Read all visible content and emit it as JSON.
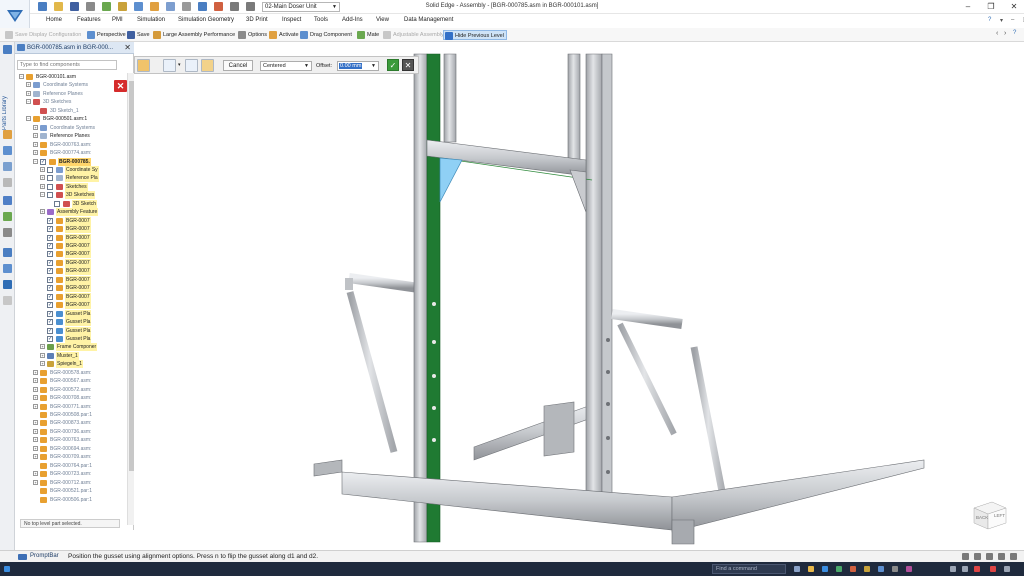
{
  "window": {
    "title": "Solid Edge - Assembly - [BGR-000785.asm in BGR-000101.asm]",
    "document_selector": "02-Main Doser Unit"
  },
  "menu": {
    "tabs": [
      "Home",
      "Features",
      "PMI",
      "Simulation",
      "Simulation Geometry",
      "3D Print",
      "Inspect",
      "Tools",
      "Add-Ins",
      "View",
      "Data Management"
    ]
  },
  "ribbon": {
    "save_display_configuration": "Save Display Configuration",
    "perspective": "Perspective",
    "save": "Save",
    "large_assembly_performance": "Large Assembly Performance",
    "options": "Options",
    "activate": "Activate",
    "drag_component": "Drag Component",
    "mate": "Mate",
    "adjustable_assembly": "Adjustable Assembly",
    "hide_previous_level": "Hide Previous Level"
  },
  "sidebar": {
    "pathfinder_tab": "Parts Library"
  },
  "pathfinder": {
    "tab_label": "BGR-000785.asm in BGR-000...",
    "search_placeholder": "Type to find components",
    "status": "No top level part selected.",
    "tree": [
      {
        "label": "BGR-000101.asm",
        "indent": 0,
        "exp": "-",
        "icon": "assembly",
        "style": "normal"
      },
      {
        "label": "Coordinate Systems",
        "indent": 1,
        "exp": "+",
        "icon": "coord",
        "style": "muted"
      },
      {
        "label": "Reference Planes",
        "indent": 1,
        "exp": "+",
        "icon": "plane",
        "style": "muted"
      },
      {
        "label": "3D Sketches",
        "indent": 1,
        "exp": "-",
        "icon": "sketch",
        "style": "muted"
      },
      {
        "label": "3D Sketch_1",
        "indent": 2,
        "icon": "sketch",
        "style": "muted"
      },
      {
        "label": "BGR-000501.asm:1",
        "indent": 1,
        "exp": "-",
        "icon": "assembly",
        "style": "normal"
      },
      {
        "label": "Coordinate Systems",
        "indent": 2,
        "exp": "+",
        "icon": "coord",
        "style": "muted"
      },
      {
        "label": "Reference Planes",
        "indent": 2,
        "exp": "+",
        "icon": "plane",
        "style": "normal"
      },
      {
        "label": "BGR-000763.asm:",
        "indent": 2,
        "exp": "+",
        "icon": "assembly",
        "style": "muted"
      },
      {
        "label": "BGR-000774.asm:",
        "indent": 2,
        "exp": "+",
        "icon": "assembly",
        "style": "muted"
      },
      {
        "label": "BGR-000785.",
        "indent": 2,
        "exp": "-",
        "check": true,
        "icon": "assembly",
        "style": "sel"
      },
      {
        "label": "Coordinate Sy",
        "indent": 3,
        "exp": "+",
        "check": false,
        "icon": "coord",
        "style": "hl"
      },
      {
        "label": "Reference Pla",
        "indent": 3,
        "exp": "+",
        "check": false,
        "icon": "plane",
        "style": "hl"
      },
      {
        "label": "Sketches",
        "indent": 3,
        "exp": "+",
        "check": false,
        "icon": "sketch",
        "style": "hl"
      },
      {
        "label": "3D Sketches",
        "indent": 3,
        "exp": "-",
        "check": false,
        "icon": "sketch",
        "style": "hl"
      },
      {
        "label": "3D Sketch",
        "indent": 4,
        "check": false,
        "icon": "sketch",
        "style": "hl"
      },
      {
        "label": "Assembly Feature",
        "indent": 3,
        "exp": "+",
        "icon": "feature",
        "style": "hl"
      },
      {
        "label": "BGR-0007",
        "indent": 3,
        "check": true,
        "icon": "part",
        "style": "hl"
      },
      {
        "label": "BGR-0007",
        "indent": 3,
        "check": true,
        "icon": "part",
        "style": "hl"
      },
      {
        "label": "BGR-0007",
        "indent": 3,
        "check": true,
        "icon": "part",
        "style": "hl"
      },
      {
        "label": "BGR-0007",
        "indent": 3,
        "check": true,
        "icon": "part",
        "style": "hl"
      },
      {
        "label": "BGR-0007",
        "indent": 3,
        "check": true,
        "icon": "part",
        "style": "hl"
      },
      {
        "label": "BGR-0007",
        "indent": 3,
        "check": true,
        "icon": "part",
        "style": "hl"
      },
      {
        "label": "BGR-0007",
        "indent": 3,
        "check": true,
        "icon": "part",
        "style": "hl"
      },
      {
        "label": "BGR-0007",
        "indent": 3,
        "check": true,
        "icon": "part",
        "style": "hl"
      },
      {
        "label": "BGR-0007",
        "indent": 3,
        "check": true,
        "icon": "part",
        "style": "hl"
      },
      {
        "label": "BGR-0007",
        "indent": 3,
        "check": true,
        "icon": "part",
        "style": "hl"
      },
      {
        "label": "BGR-0007",
        "indent": 3,
        "check": true,
        "icon": "part",
        "style": "hl"
      },
      {
        "label": "Gusset Pla",
        "indent": 3,
        "check": true,
        "icon": "gusset",
        "style": "hl"
      },
      {
        "label": "Gusset Pla",
        "indent": 3,
        "check": true,
        "icon": "gusset",
        "style": "hl"
      },
      {
        "label": "Gusset Pla",
        "indent": 3,
        "check": true,
        "icon": "gusset",
        "style": "hl"
      },
      {
        "label": "Gusset Pla",
        "indent": 3,
        "check": true,
        "icon": "gusset",
        "style": "hl"
      },
      {
        "label": "Frame Componer",
        "indent": 3,
        "exp": "+",
        "icon": "frame",
        "style": "hl"
      },
      {
        "label": "Muster_1",
        "indent": 3,
        "exp": "+",
        "icon": "pattern",
        "style": "hl"
      },
      {
        "label": "Spiegeln_1",
        "indent": 3,
        "exp": "+",
        "icon": "mirror",
        "style": "hl"
      },
      {
        "label": "BGR-000578.asm:",
        "indent": 2,
        "exp": "+",
        "icon": "assembly",
        "style": "muted"
      },
      {
        "label": "BGR-000567.asm:",
        "indent": 2,
        "exp": "+",
        "icon": "assembly",
        "style": "muted"
      },
      {
        "label": "BGR-000572.asm:",
        "indent": 2,
        "exp": "+",
        "icon": "assembly",
        "style": "muted"
      },
      {
        "label": "BGR-000708.asm:",
        "indent": 2,
        "exp": "+",
        "icon": "assembly",
        "style": "muted"
      },
      {
        "label": "BGR-000771.asm:",
        "indent": 2,
        "exp": "+",
        "icon": "assembly",
        "style": "muted"
      },
      {
        "label": "BGR-000508.par:1",
        "indent": 2,
        "icon": "part",
        "style": "muted"
      },
      {
        "label": "BGR-000873.asm:",
        "indent": 2,
        "exp": "+",
        "icon": "assembly",
        "style": "muted"
      },
      {
        "label": "BGR-000736.asm:",
        "indent": 2,
        "exp": "+",
        "icon": "assembly",
        "style": "muted"
      },
      {
        "label": "BGR-000763.asm:",
        "indent": 2,
        "exp": "+",
        "icon": "assembly",
        "style": "muted"
      },
      {
        "label": "BGR-000694.asm:",
        "indent": 2,
        "exp": "+",
        "icon": "assembly",
        "style": "muted"
      },
      {
        "label": "BGR-000709.asm:",
        "indent": 2,
        "exp": "+",
        "icon": "assembly",
        "style": "muted"
      },
      {
        "label": "BGR-000764.par:1",
        "indent": 2,
        "icon": "part",
        "style": "muted"
      },
      {
        "label": "BGR-000723.asm:",
        "indent": 2,
        "exp": "+",
        "icon": "assembly",
        "style": "muted"
      },
      {
        "label": "BGR-000712.asm:",
        "indent": 2,
        "exp": "+",
        "icon": "assembly",
        "style": "muted"
      },
      {
        "label": "BGR-000521.par:1",
        "indent": 2,
        "icon": "part",
        "style": "muted"
      },
      {
        "label": "BGR-000506.par:1",
        "indent": 2,
        "icon": "part",
        "style": "muted"
      }
    ]
  },
  "command_bar": {
    "cancel": "Cancel",
    "alignment": "Centered",
    "offset_label": "Offset:",
    "offset_value": "0.00 mm"
  },
  "viewcube": {
    "back": "BACK",
    "left": "LEFT"
  },
  "prompt": {
    "tab": "PromptBar",
    "message": "Position the gusset using alignment options. Press n to flip the gusset along d1 and d2."
  },
  "taskbar": {
    "search_placeholder": "Find a command"
  },
  "colors": {
    "accent": "#3370c7",
    "selection": "#ffd56b",
    "highlight": "#fff3a6",
    "frame_green": "#1f7a32",
    "gusset_blue": "#8fd0f5",
    "steel": "#c9cbcf"
  }
}
